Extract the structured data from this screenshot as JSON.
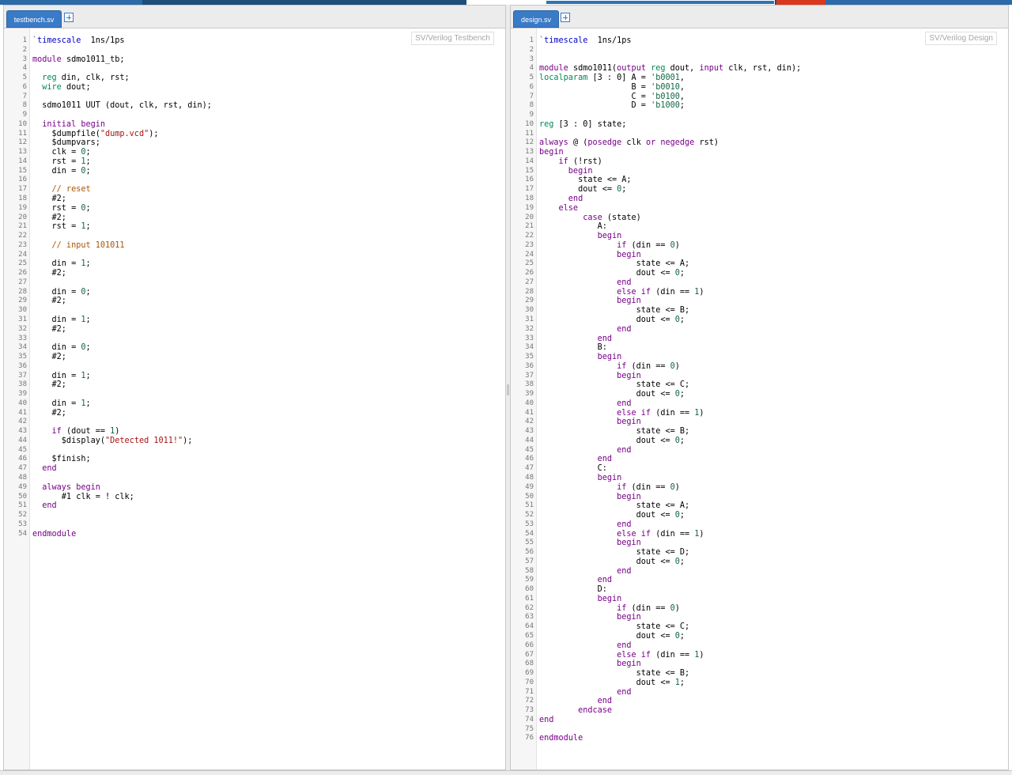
{
  "left": {
    "tab_label": "testbench.sv",
    "mode_label": "SV/Verilog Testbench",
    "lines": [
      [
        [
          "dir",
          "`"
        ],
        [
          "var",
          "timescale"
        ],
        [
          "",
          "  1ns/1ps"
        ]
      ],
      [],
      [
        [
          "kw",
          "module"
        ],
        [
          "",
          " sdmo1011_tb;"
        ]
      ],
      [],
      [
        [
          "",
          ""
        ],
        [
          "ty",
          "  reg"
        ],
        [
          "",
          " din, clk, rst;"
        ]
      ],
      [
        [
          "ty",
          "  wire"
        ],
        [
          "",
          " dout;"
        ]
      ],
      [],
      [
        [
          "",
          "  sdmo1011 UUT (dout, clk, rst, din);"
        ]
      ],
      [],
      [
        [
          "kw",
          "  initial begin"
        ]
      ],
      [
        [
          "",
          "    $dumpfile("
        ],
        [
          "str",
          "\"dump.vcd\""
        ],
        [
          "",
          ");"
        ]
      ],
      [
        [
          "",
          "    $dumpvars;"
        ]
      ],
      [
        [
          "",
          "    clk = "
        ],
        [
          "num",
          "0"
        ],
        [
          "",
          ";"
        ]
      ],
      [
        [
          "",
          "    rst = "
        ],
        [
          "num",
          "1"
        ],
        [
          "",
          ";"
        ]
      ],
      [
        [
          "",
          "    din = "
        ],
        [
          "num",
          "0"
        ],
        [
          "",
          ";"
        ]
      ],
      [],
      [
        [
          "cm",
          "    // reset"
        ]
      ],
      [
        [
          "",
          "    #2;"
        ]
      ],
      [
        [
          "",
          "    rst = "
        ],
        [
          "num",
          "0"
        ],
        [
          "",
          ";"
        ]
      ],
      [
        [
          "",
          "    #2;"
        ]
      ],
      [
        [
          "",
          "    rst = "
        ],
        [
          "num",
          "1"
        ],
        [
          "",
          ";"
        ]
      ],
      [],
      [
        [
          "cm",
          "    // input 101011"
        ]
      ],
      [],
      [
        [
          "",
          "    din = "
        ],
        [
          "num",
          "1"
        ],
        [
          "",
          ";"
        ]
      ],
      [
        [
          "",
          "    #2;"
        ]
      ],
      [],
      [
        [
          "",
          "    din = "
        ],
        [
          "num",
          "0"
        ],
        [
          "",
          ";"
        ]
      ],
      [
        [
          "",
          "    #2;"
        ]
      ],
      [],
      [
        [
          "",
          "    din = "
        ],
        [
          "num",
          "1"
        ],
        [
          "",
          ";"
        ]
      ],
      [
        [
          "",
          "    #2;"
        ]
      ],
      [],
      [
        [
          "",
          "    din = "
        ],
        [
          "num",
          "0"
        ],
        [
          "",
          ";"
        ]
      ],
      [
        [
          "",
          "    #2;"
        ]
      ],
      [],
      [
        [
          "",
          "    din = "
        ],
        [
          "num",
          "1"
        ],
        [
          "",
          ";"
        ]
      ],
      [
        [
          "",
          "    #2;"
        ]
      ],
      [],
      [
        [
          "",
          "    din = "
        ],
        [
          "num",
          "1"
        ],
        [
          "",
          ";"
        ]
      ],
      [
        [
          "",
          "    #2;"
        ]
      ],
      [],
      [
        [
          "kw",
          "    if"
        ],
        [
          "",
          " (dout == "
        ],
        [
          "num",
          "1"
        ],
        [
          "",
          ")"
        ]
      ],
      [
        [
          "",
          "      $display("
        ],
        [
          "str",
          "\"Detected 1011!\""
        ],
        [
          "",
          ");"
        ]
      ],
      [],
      [
        [
          "",
          "    $finish;"
        ]
      ],
      [
        [
          "kw",
          "  end"
        ]
      ],
      [],
      [
        [
          "kw",
          "  always begin"
        ]
      ],
      [
        [
          "",
          "      #1 clk = ! clk;"
        ]
      ],
      [
        [
          "kw",
          "  end"
        ]
      ],
      [],
      [],
      [
        [
          "kw",
          "endmodule"
        ]
      ]
    ]
  },
  "right": {
    "tab_label": "design.sv",
    "mode_label": "SV/Verilog Design",
    "lines": [
      [
        [
          "dir",
          "`"
        ],
        [
          "var",
          "timescale"
        ],
        [
          "",
          "  1ns/1ps"
        ]
      ],
      [],
      [],
      [
        [
          "kw",
          "module"
        ],
        [
          "",
          " sdmo1011("
        ],
        [
          "kw",
          "output"
        ],
        [
          "ty",
          " reg"
        ],
        [
          "",
          " dout, "
        ],
        [
          "kw",
          "input"
        ],
        [
          "",
          " clk, rst, din);"
        ]
      ],
      [
        [
          "ty",
          "localparam"
        ],
        [
          "",
          " [3 : 0] A = "
        ],
        [
          "num",
          "'b0001"
        ],
        [
          "",
          ","
        ]
      ],
      [
        [
          "",
          "                   B = "
        ],
        [
          "num",
          "'b0010"
        ],
        [
          "",
          ","
        ]
      ],
      [
        [
          "",
          "                   C = "
        ],
        [
          "num",
          "'b0100"
        ],
        [
          "",
          ","
        ]
      ],
      [
        [
          "",
          "                   D = "
        ],
        [
          "num",
          "'b1000"
        ],
        [
          "",
          ";"
        ]
      ],
      [],
      [
        [
          "ty",
          "reg"
        ],
        [
          "",
          " [3 : 0] state;"
        ]
      ],
      [],
      [
        [
          "kw",
          "always"
        ],
        [
          "",
          " @ ("
        ],
        [
          "kw",
          "posedge"
        ],
        [
          "",
          " clk "
        ],
        [
          "kw",
          "or"
        ],
        [
          "kw",
          " negedge"
        ],
        [
          "",
          " rst)"
        ]
      ],
      [
        [
          "kw",
          "begin"
        ]
      ],
      [
        [
          "kw",
          "    if"
        ],
        [
          "",
          " (!rst)"
        ]
      ],
      [
        [
          "kw",
          "      begin"
        ]
      ],
      [
        [
          "",
          "        state <= A;"
        ]
      ],
      [
        [
          "",
          "        dout <= "
        ],
        [
          "num",
          "0"
        ],
        [
          "",
          ";"
        ]
      ],
      [
        [
          "kw",
          "      end"
        ]
      ],
      [
        [
          "kw",
          "    else"
        ]
      ],
      [
        [
          "kw",
          "         case"
        ],
        [
          "",
          " (state)"
        ]
      ],
      [
        [
          "",
          "            A:"
        ]
      ],
      [
        [
          "kw",
          "            begin"
        ]
      ],
      [
        [
          "kw",
          "                if"
        ],
        [
          "",
          " (din == "
        ],
        [
          "num",
          "0"
        ],
        [
          "",
          ")"
        ]
      ],
      [
        [
          "kw",
          "                begin"
        ]
      ],
      [
        [
          "",
          "                    state <= A;"
        ]
      ],
      [
        [
          "",
          "                    dout <= "
        ],
        [
          "num",
          "0"
        ],
        [
          "",
          ";"
        ]
      ],
      [
        [
          "kw",
          "                end"
        ]
      ],
      [
        [
          "kw",
          "                else if"
        ],
        [
          "",
          " (din == "
        ],
        [
          "num",
          "1"
        ],
        [
          "",
          ")"
        ]
      ],
      [
        [
          "kw",
          "                begin"
        ]
      ],
      [
        [
          "",
          "                    state <= B;"
        ]
      ],
      [
        [
          "",
          "                    dout <= "
        ],
        [
          "num",
          "0"
        ],
        [
          "",
          ";"
        ]
      ],
      [
        [
          "kw",
          "                end"
        ]
      ],
      [
        [
          "kw",
          "            end"
        ]
      ],
      [
        [
          "",
          "            B:"
        ]
      ],
      [
        [
          "kw",
          "            begin"
        ]
      ],
      [
        [
          "kw",
          "                if"
        ],
        [
          "",
          " (din == "
        ],
        [
          "num",
          "0"
        ],
        [
          "",
          ")"
        ]
      ],
      [
        [
          "kw",
          "                begin"
        ]
      ],
      [
        [
          "",
          "                    state <= C;"
        ]
      ],
      [
        [
          "",
          "                    dout <= "
        ],
        [
          "num",
          "0"
        ],
        [
          "",
          ";"
        ]
      ],
      [
        [
          "kw",
          "                end"
        ]
      ],
      [
        [
          "kw",
          "                else if"
        ],
        [
          "",
          " (din == "
        ],
        [
          "num",
          "1"
        ],
        [
          "",
          ")"
        ]
      ],
      [
        [
          "kw",
          "                begin"
        ]
      ],
      [
        [
          "",
          "                    state <= B;"
        ]
      ],
      [
        [
          "",
          "                    dout <= "
        ],
        [
          "num",
          "0"
        ],
        [
          "",
          ";"
        ]
      ],
      [
        [
          "kw",
          "                end"
        ]
      ],
      [
        [
          "kw",
          "            end"
        ]
      ],
      [
        [
          "",
          "            C:"
        ]
      ],
      [
        [
          "kw",
          "            begin"
        ]
      ],
      [
        [
          "kw",
          "                if"
        ],
        [
          "",
          " (din == "
        ],
        [
          "num",
          "0"
        ],
        [
          "",
          ")"
        ]
      ],
      [
        [
          "kw",
          "                begin"
        ]
      ],
      [
        [
          "",
          "                    state <= A;"
        ]
      ],
      [
        [
          "",
          "                    dout <= "
        ],
        [
          "num",
          "0"
        ],
        [
          "",
          ";"
        ]
      ],
      [
        [
          "kw",
          "                end"
        ]
      ],
      [
        [
          "kw",
          "                else if"
        ],
        [
          "",
          " (din == "
        ],
        [
          "num",
          "1"
        ],
        [
          "",
          ")"
        ]
      ],
      [
        [
          "kw",
          "                begin"
        ]
      ],
      [
        [
          "",
          "                    state <= D;"
        ]
      ],
      [
        [
          "",
          "                    dout <= "
        ],
        [
          "num",
          "0"
        ],
        [
          "",
          ";"
        ]
      ],
      [
        [
          "kw",
          "                end"
        ]
      ],
      [
        [
          "kw",
          "            end"
        ]
      ],
      [
        [
          "",
          "            D:"
        ]
      ],
      [
        [
          "kw",
          "            begin"
        ]
      ],
      [
        [
          "kw",
          "                if"
        ],
        [
          "",
          " (din == "
        ],
        [
          "num",
          "0"
        ],
        [
          "",
          ")"
        ]
      ],
      [
        [
          "kw",
          "                begin"
        ]
      ],
      [
        [
          "",
          "                    state <= C;"
        ]
      ],
      [
        [
          "",
          "                    dout <= "
        ],
        [
          "num",
          "0"
        ],
        [
          "",
          ";"
        ]
      ],
      [
        [
          "kw",
          "                end"
        ]
      ],
      [
        [
          "kw",
          "                else if"
        ],
        [
          "",
          " (din == "
        ],
        [
          "num",
          "1"
        ],
        [
          "",
          ")"
        ]
      ],
      [
        [
          "kw",
          "                begin"
        ]
      ],
      [
        [
          "",
          "                    state <= B;"
        ]
      ],
      [
        [
          "",
          "                    dout <= "
        ],
        [
          "num",
          "1"
        ],
        [
          "",
          ";"
        ]
      ],
      [
        [
          "kw",
          "                end"
        ]
      ],
      [
        [
          "kw",
          "            end"
        ]
      ],
      [
        [
          "kw",
          "        endcase"
        ]
      ],
      [
        [
          "kw",
          "end"
        ]
      ],
      [],
      [
        [
          "kw",
          "endmodule"
        ]
      ]
    ]
  }
}
